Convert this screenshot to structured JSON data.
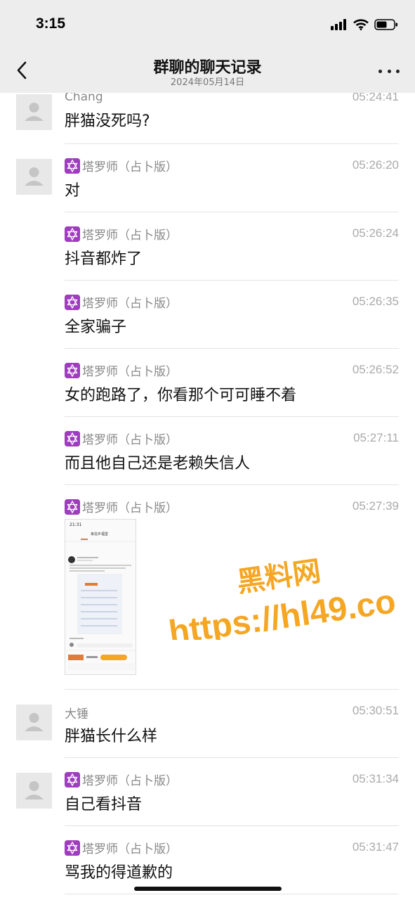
{
  "status_bar": {
    "time": "3:15"
  },
  "nav": {
    "title": "群聊的聊天记录",
    "subtitle": "2024年05月14日"
  },
  "messages": [
    {
      "sender": "Chang",
      "time": "05:24:41",
      "text": "胖猫没死吗?"
    },
    {
      "sender": "塔罗师（占卜版）",
      "time": "05:26:20",
      "text": "对"
    },
    {
      "sender": "塔罗师（占卜版）",
      "time": "05:26:24",
      "text": "抖音都炸了"
    },
    {
      "sender": "塔罗师（占卜版）",
      "time": "05:26:35",
      "text": "全家骗子"
    },
    {
      "sender": "塔罗师（占卜版）",
      "time": "05:26:52",
      "text": "女的跑路了，你看那个可可睡不着"
    },
    {
      "sender": "塔罗师（占卜版）",
      "time": "05:27:11",
      "text": "而且他自己还是老赖失信人"
    },
    {
      "sender": "塔罗师（占卜版）",
      "time": "05:27:39",
      "text": ""
    },
    {
      "sender": "大锤",
      "time": "05:30:51",
      "text": "胖猫长什么样"
    },
    {
      "sender": "塔罗师（占卜版）",
      "time": "05:31:34",
      "text": "自己看抖音"
    },
    {
      "sender": "塔罗师（占卜版）",
      "time": "05:31:47",
      "text": "骂我的得道歉的"
    }
  ],
  "screenshot_thumb": {
    "time": "21:31",
    "title": "来信乡福堂"
  },
  "watermark": {
    "line1": "黑料网",
    "line2": "https://hl49.co"
  },
  "colors": {
    "watermark": "#f5a623",
    "tarot_icon": "#9f3cc0",
    "header_bg": "#ededed"
  }
}
